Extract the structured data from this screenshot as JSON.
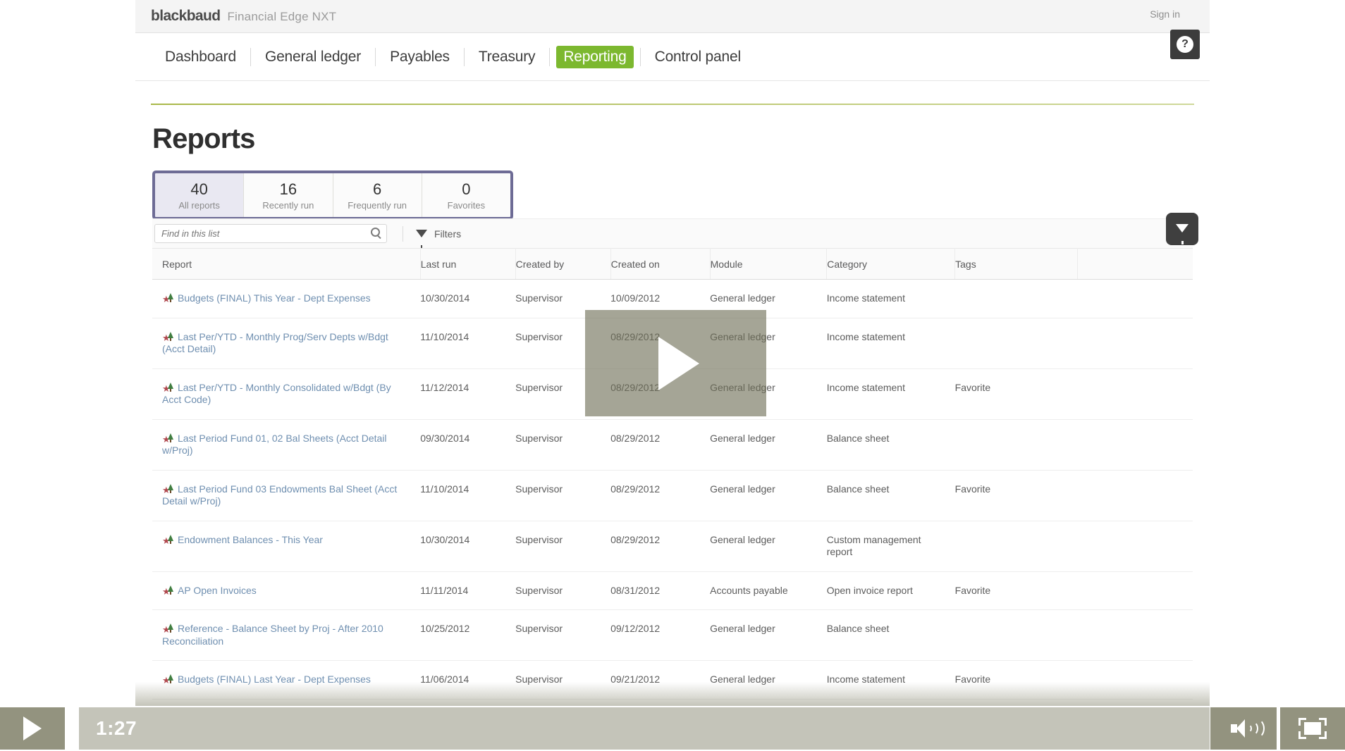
{
  "brand": {
    "logo": "blackbaud",
    "product": "Financial Edge NXT",
    "signin": "Sign in"
  },
  "nav": {
    "items": [
      {
        "label": "Dashboard",
        "active": false
      },
      {
        "label": "General ledger",
        "active": false
      },
      {
        "label": "Payables",
        "active": false
      },
      {
        "label": "Treasury",
        "active": false
      },
      {
        "label": "Reporting",
        "active": true
      },
      {
        "label": "Control panel",
        "active": false
      }
    ],
    "help_glyph": "?",
    "accent_green": "#7cb82f"
  },
  "page": {
    "title": "Reports"
  },
  "tabs": {
    "border_color": "#6d6b95",
    "items": [
      {
        "count": "40",
        "label": "All reports",
        "active": true
      },
      {
        "count": "16",
        "label": "Recently run",
        "active": false
      },
      {
        "count": "6",
        "label": "Frequently run",
        "active": false
      },
      {
        "count": "0",
        "label": "Favorites",
        "active": false
      }
    ]
  },
  "search": {
    "placeholder": "Find in this list",
    "value": "",
    "filters_label": "Filters"
  },
  "table": {
    "columns": [
      "Report",
      "Last run",
      "Created by",
      "Created on",
      "Module",
      "Category",
      "Tags"
    ],
    "rows": [
      {
        "report": "Budgets (FINAL) This Year - Dept Expenses",
        "last_run": "10/30/2014",
        "created_by": "Supervisor",
        "created_on": "10/09/2012",
        "module": "General ledger",
        "category": "Income statement",
        "tags": ""
      },
      {
        "report": "Last Per/YTD - Monthly Prog/Serv Depts w/Bdgt (Acct Detail)",
        "last_run": "11/10/2014",
        "created_by": "Supervisor",
        "created_on": "08/29/2012",
        "module": "General ledger",
        "category": "Income statement",
        "tags": ""
      },
      {
        "report": "Last Per/YTD - Monthly Consolidated w/Bdgt (By Acct Code)",
        "last_run": "11/12/2014",
        "created_by": "Supervisor",
        "created_on": "08/29/2012",
        "module": "General ledger",
        "category": "Income statement",
        "tags": "Favorite"
      },
      {
        "report": "Last Period Fund 01, 02 Bal Sheets (Acct Detail w/Proj)",
        "last_run": "09/30/2014",
        "created_by": "Supervisor",
        "created_on": "08/29/2012",
        "module": "General ledger",
        "category": "Balance sheet",
        "tags": ""
      },
      {
        "report": "Last Period Fund 03 Endowments Bal Sheet (Acct Detail w/Proj)",
        "last_run": "11/10/2014",
        "created_by": "Supervisor",
        "created_on": "08/29/2012",
        "module": "General ledger",
        "category": "Balance sheet",
        "tags": "Favorite"
      },
      {
        "report": "Endowment Balances - This Year",
        "last_run": "10/30/2014",
        "created_by": "Supervisor",
        "created_on": "08/29/2012",
        "module": "General ledger",
        "category": "Custom management report",
        "tags": ""
      },
      {
        "report": "AP Open Invoices",
        "last_run": "11/11/2014",
        "created_by": "Supervisor",
        "created_on": "08/31/2012",
        "module": "Accounts payable",
        "category": "Open invoice report",
        "tags": "Favorite"
      },
      {
        "report": "Reference - Balance Sheet by Proj - After 2010 Reconciliation",
        "last_run": "10/25/2012",
        "created_by": "Supervisor",
        "created_on": "09/12/2012",
        "module": "General ledger",
        "category": "Balance sheet",
        "tags": ""
      },
      {
        "report": "Budgets (FINAL) Last Year - Dept Expenses",
        "last_run": "11/06/2014",
        "created_by": "Supervisor",
        "created_on": "09/21/2012",
        "module": "General ledger",
        "category": "Income statement",
        "tags": "Favorite"
      }
    ]
  },
  "video": {
    "time": "1:27"
  }
}
